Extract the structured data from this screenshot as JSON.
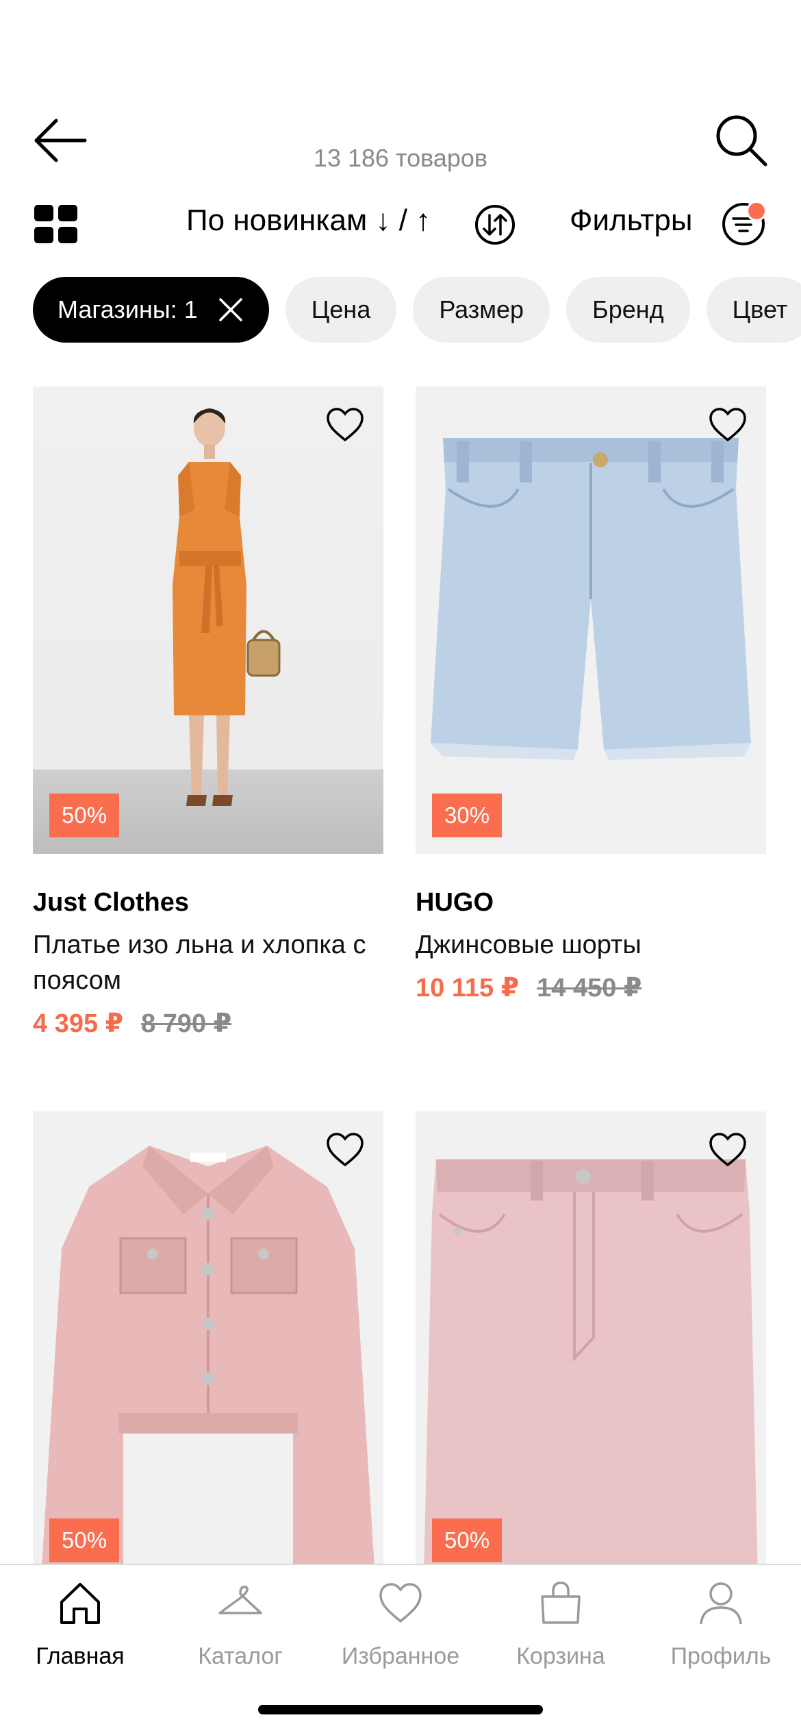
{
  "header": {
    "count": "13 186 товаров"
  },
  "toolbar": {
    "sort_label": "По новинкам ↓ / ↑",
    "filters_label": "Фильтры"
  },
  "chips": [
    {
      "label": "Магазины: 1",
      "active": true
    },
    {
      "label": "Цена"
    },
    {
      "label": "Размер"
    },
    {
      "label": "Бренд"
    },
    {
      "label": "Цвет"
    }
  ],
  "products": [
    {
      "brand": "Just Clothes",
      "title": "Платье изо льна и хлопка с поясом",
      "discount": "50%",
      "price": "4 395 ₽",
      "old_price": "8 790 ₽"
    },
    {
      "brand": "HUGO",
      "title": "Джинсовые шорты",
      "discount": "30%",
      "price": "10 115 ₽",
      "old_price": "14 450 ₽"
    },
    {
      "brand": "",
      "title": "",
      "discount": "50%",
      "price": "",
      "old_price": ""
    },
    {
      "brand": "",
      "title": "",
      "discount": "50%",
      "price": "",
      "old_price": ""
    }
  ],
  "tabs": [
    {
      "label": "Главная",
      "icon": "home-icon",
      "active": true
    },
    {
      "label": "Каталог",
      "icon": "hanger-icon"
    },
    {
      "label": "Избранное",
      "icon": "heart-icon"
    },
    {
      "label": "Корзина",
      "icon": "bag-icon"
    },
    {
      "label": "Профиль",
      "icon": "profile-icon"
    }
  ],
  "colors": {
    "accent": "#fa6e4f",
    "chip_bg": "#efefef",
    "muted": "#8a8a8a"
  }
}
